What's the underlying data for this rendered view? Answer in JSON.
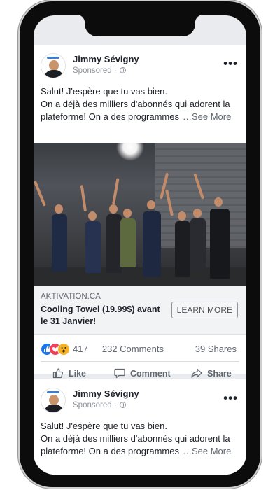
{
  "post1": {
    "author": "Jimmy Sévigny",
    "sponsored": "Sponsored ·",
    "more": "•••",
    "text_line1": "Salut! J'espère que tu vas bien.",
    "text_line2": "On a déjà des milliers d'abonnés qui adorent la",
    "text_line3": "plateforme! On a des programmes",
    "see_more": "…See More",
    "site": "AKTIVATION.CA",
    "headline": "Cooling Towel (19.99$) avant le 31 Janvier!",
    "cta": "LEARN MORE",
    "reaction_count": "417",
    "comments": "232 Comments",
    "shares": "39 Shares",
    "action_like": "Like",
    "action_comment": "Comment",
    "action_share": "Share"
  },
  "post2": {
    "author": "Jimmy Sévigny",
    "sponsored": "Sponsored ·",
    "more": "•••",
    "text_line1": "Salut! J'espère que tu vas bien.",
    "text_line2": "On a déjà des milliers d'abonnés qui adorent la",
    "text_line3": "plateforme! On a des programmes",
    "see_more": "…See More"
  },
  "colors": {
    "like_blue": "#1877f2",
    "love_red": "#f33e58",
    "wow_yellow": "#f7b125",
    "feed_bg": "#e9ebee"
  },
  "icons": {
    "reactions": [
      "like-reaction-icon",
      "love-reaction-icon",
      "wow-reaction-icon"
    ],
    "actions": [
      "thumbs-up-icon",
      "comment-bubble-icon",
      "share-arrow-icon"
    ]
  }
}
